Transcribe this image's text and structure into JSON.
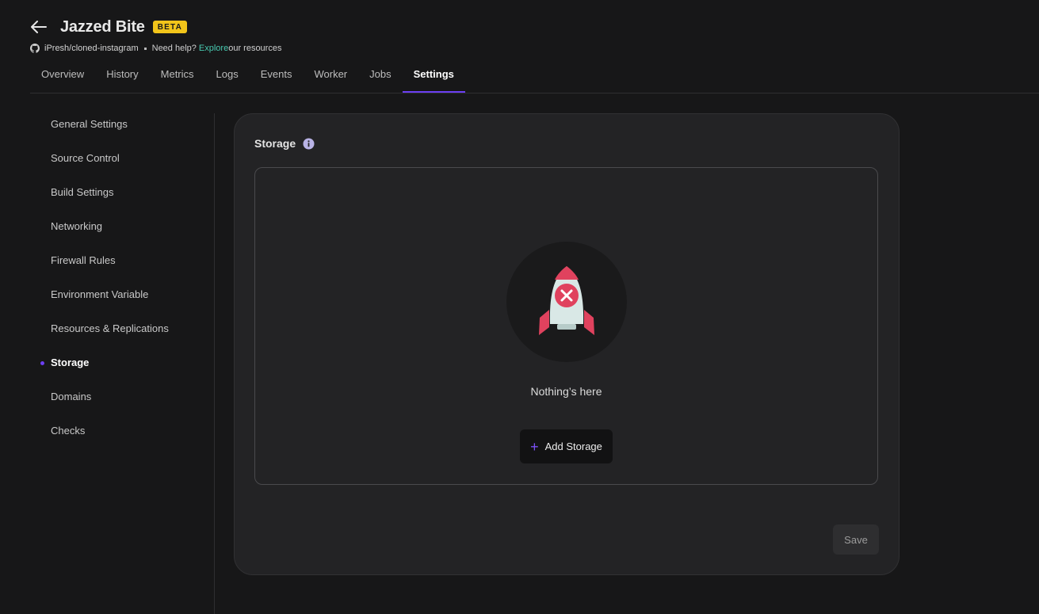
{
  "app": {
    "title": "Jazzed Bite",
    "badge": "BETA",
    "repo": "iPresh/cloned-instagram",
    "help_prefix": "Need help?",
    "help_link": "Explore",
    "help_suffix": "our resources"
  },
  "tabs": [
    {
      "label": "Overview"
    },
    {
      "label": "History"
    },
    {
      "label": "Metrics"
    },
    {
      "label": "Logs"
    },
    {
      "label": "Events"
    },
    {
      "label": "Worker"
    },
    {
      "label": "Jobs"
    },
    {
      "label": "Settings",
      "active": true
    }
  ],
  "sidebar": {
    "items": [
      {
        "label": "General Settings"
      },
      {
        "label": "Source Control"
      },
      {
        "label": "Build Settings"
      },
      {
        "label": "Networking"
      },
      {
        "label": "Firewall Rules"
      },
      {
        "label": "Environment Variable"
      },
      {
        "label": "Resources & Replications"
      },
      {
        "label": "Storage",
        "active": true
      },
      {
        "label": "Domains"
      },
      {
        "label": "Checks"
      }
    ]
  },
  "storage": {
    "title": "Storage",
    "empty_text": "Nothing’s here",
    "add_label": "Add Storage",
    "save_label": "Save"
  },
  "colors": {
    "accent": "#6c3ff2",
    "badge": "#f2c51a",
    "link": "#48c9b0",
    "rocket_red": "#e0425e"
  },
  "icons": {
    "back": "arrow-left-icon",
    "repo": "github-icon",
    "info": "info-icon",
    "empty": "rocket-error-icon",
    "add": "plus-icon"
  }
}
